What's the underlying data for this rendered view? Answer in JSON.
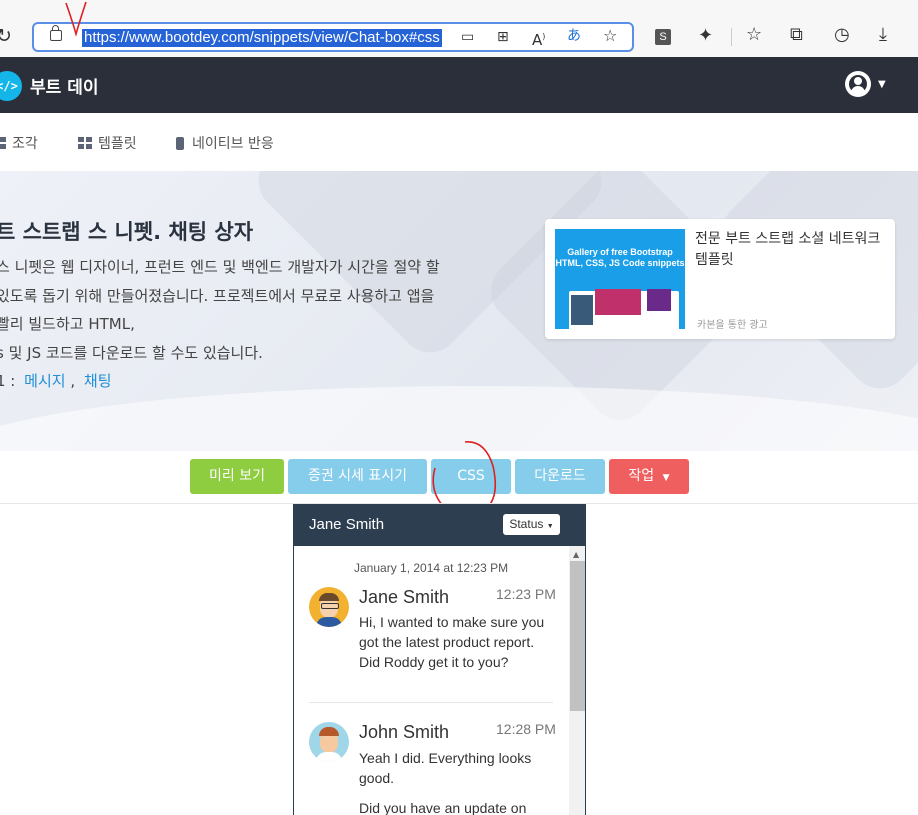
{
  "browser": {
    "url": "https://www.bootdey.com/snippets/view/Chat-box#css",
    "icons": [
      "reload-icon",
      "lock-icon",
      "read-aloud-icon",
      "qr-icon",
      "font-icon",
      "translate-icon",
      "favorite-add-icon",
      "extension-s-icon",
      "puzzle-icon",
      "favorites-icon",
      "collections-icon",
      "history-icon",
      "download-icon"
    ]
  },
  "nav": {
    "brand": "부트 데이",
    "logo": "</>"
  },
  "subnav": {
    "items": [
      "조각",
      "템플릿",
      "네이티브 반응"
    ]
  },
  "hero": {
    "title": "트 스트랩 스 니펫. 채팅 상자",
    "lines": [
      "스 니펫은 웹 디자이너, 프런트 엔드 및 백엔드 개발자가 시간을 절약 할",
      "있도록 돕기 위해 만들어졌습니다. 프로젝트에서 무료로 사용하고 앱을",
      "빨리 빌드하고 HTML,",
      "s 및 JS 코드를 다운로드 할 수도 있습니다."
    ],
    "tags_prefix": "1 :",
    "tags": [
      "메시지",
      "채팅"
    ],
    "tag_separator": ","
  },
  "ad": {
    "image_text": "Gallery of free Bootstrap HTML, CSS, JS Code snippets",
    "text": "전문 부트 스트랩 소셜 네트워크 템플릿",
    "via": "카본을 통한 광고"
  },
  "buttons": {
    "preview": "미리 보기",
    "fullscreen": "증권 시세 표시기",
    "css": "CSS",
    "download": "다운로드",
    "action": "작업"
  },
  "colors": {
    "preview": "#8dcd3f",
    "fullscreen": "#85cdea",
    "css": "#85cdea",
    "download": "#85cdea",
    "action": "#f05f5f",
    "navbar": "#2a2f3a",
    "chat_header": "#2c3e50"
  },
  "chat": {
    "header_name": "Jane Smith",
    "status_label": "Status",
    "date": "January 1, 2014 at 12:23 PM",
    "messages": [
      {
        "name": "Jane Smith",
        "time": "12:23 PM",
        "text": "Hi, I wanted to make sure you got the latest product report. Did Roddy get it to you?"
      },
      {
        "name": "John Smith",
        "time": "12:28 PM",
        "text": "Yeah I did. Everything looks good.",
        "text2": "Did you have an update on"
      }
    ]
  }
}
